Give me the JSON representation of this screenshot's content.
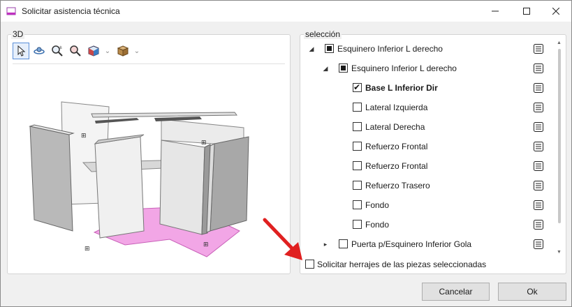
{
  "window": {
    "title": "Solicitar asistencia técnica"
  },
  "groups": {
    "view3d_label": "3D",
    "selection_label": "selección"
  },
  "toolbar": {
    "icons": [
      "cursor-icon",
      "orbit-icon",
      "zoom-extents-icon",
      "zoom-icon",
      "view-cube-icon",
      "box-icon"
    ]
  },
  "tree": {
    "rows": [
      {
        "label": "Esquinero Inferior L derecho",
        "state": "partial",
        "level": 0,
        "expanded": true,
        "bold": false
      },
      {
        "label": "Esquinero Inferior L derecho",
        "state": "partial",
        "level": 1,
        "expanded": true,
        "bold": false
      },
      {
        "label": "Base L Inferior Dir",
        "state": "checked",
        "level": 2,
        "bold": true
      },
      {
        "label": "Lateral Izquierda",
        "state": "unchecked",
        "level": 2,
        "bold": false
      },
      {
        "label": "Lateral Derecha",
        "state": "unchecked",
        "level": 2,
        "bold": false
      },
      {
        "label": "Refuerzo Frontal",
        "state": "unchecked",
        "level": 2,
        "bold": false
      },
      {
        "label": "Refuerzo Frontal",
        "state": "unchecked",
        "level": 2,
        "bold": false
      },
      {
        "label": "Refuerzo Trasero",
        "state": "unchecked",
        "level": 2,
        "bold": false
      },
      {
        "label": "Fondo",
        "state": "unchecked",
        "level": 2,
        "bold": false
      },
      {
        "label": "Fondo",
        "state": "unchecked",
        "level": 2,
        "bold": false
      },
      {
        "label": "Puerta p/Esquinero Inferior Gola",
        "state": "unchecked",
        "level": 1,
        "expanded": false,
        "bold": false
      }
    ]
  },
  "request_hardware_label": "Solicitar herrajes de las piezas seleccionadas",
  "buttons": {
    "cancel": "Cancelar",
    "ok": "Ok"
  },
  "colors": {
    "highlight_piece": "#f2a6e6",
    "arrow": "#e02020",
    "selection_border": "#5a8ed8"
  }
}
